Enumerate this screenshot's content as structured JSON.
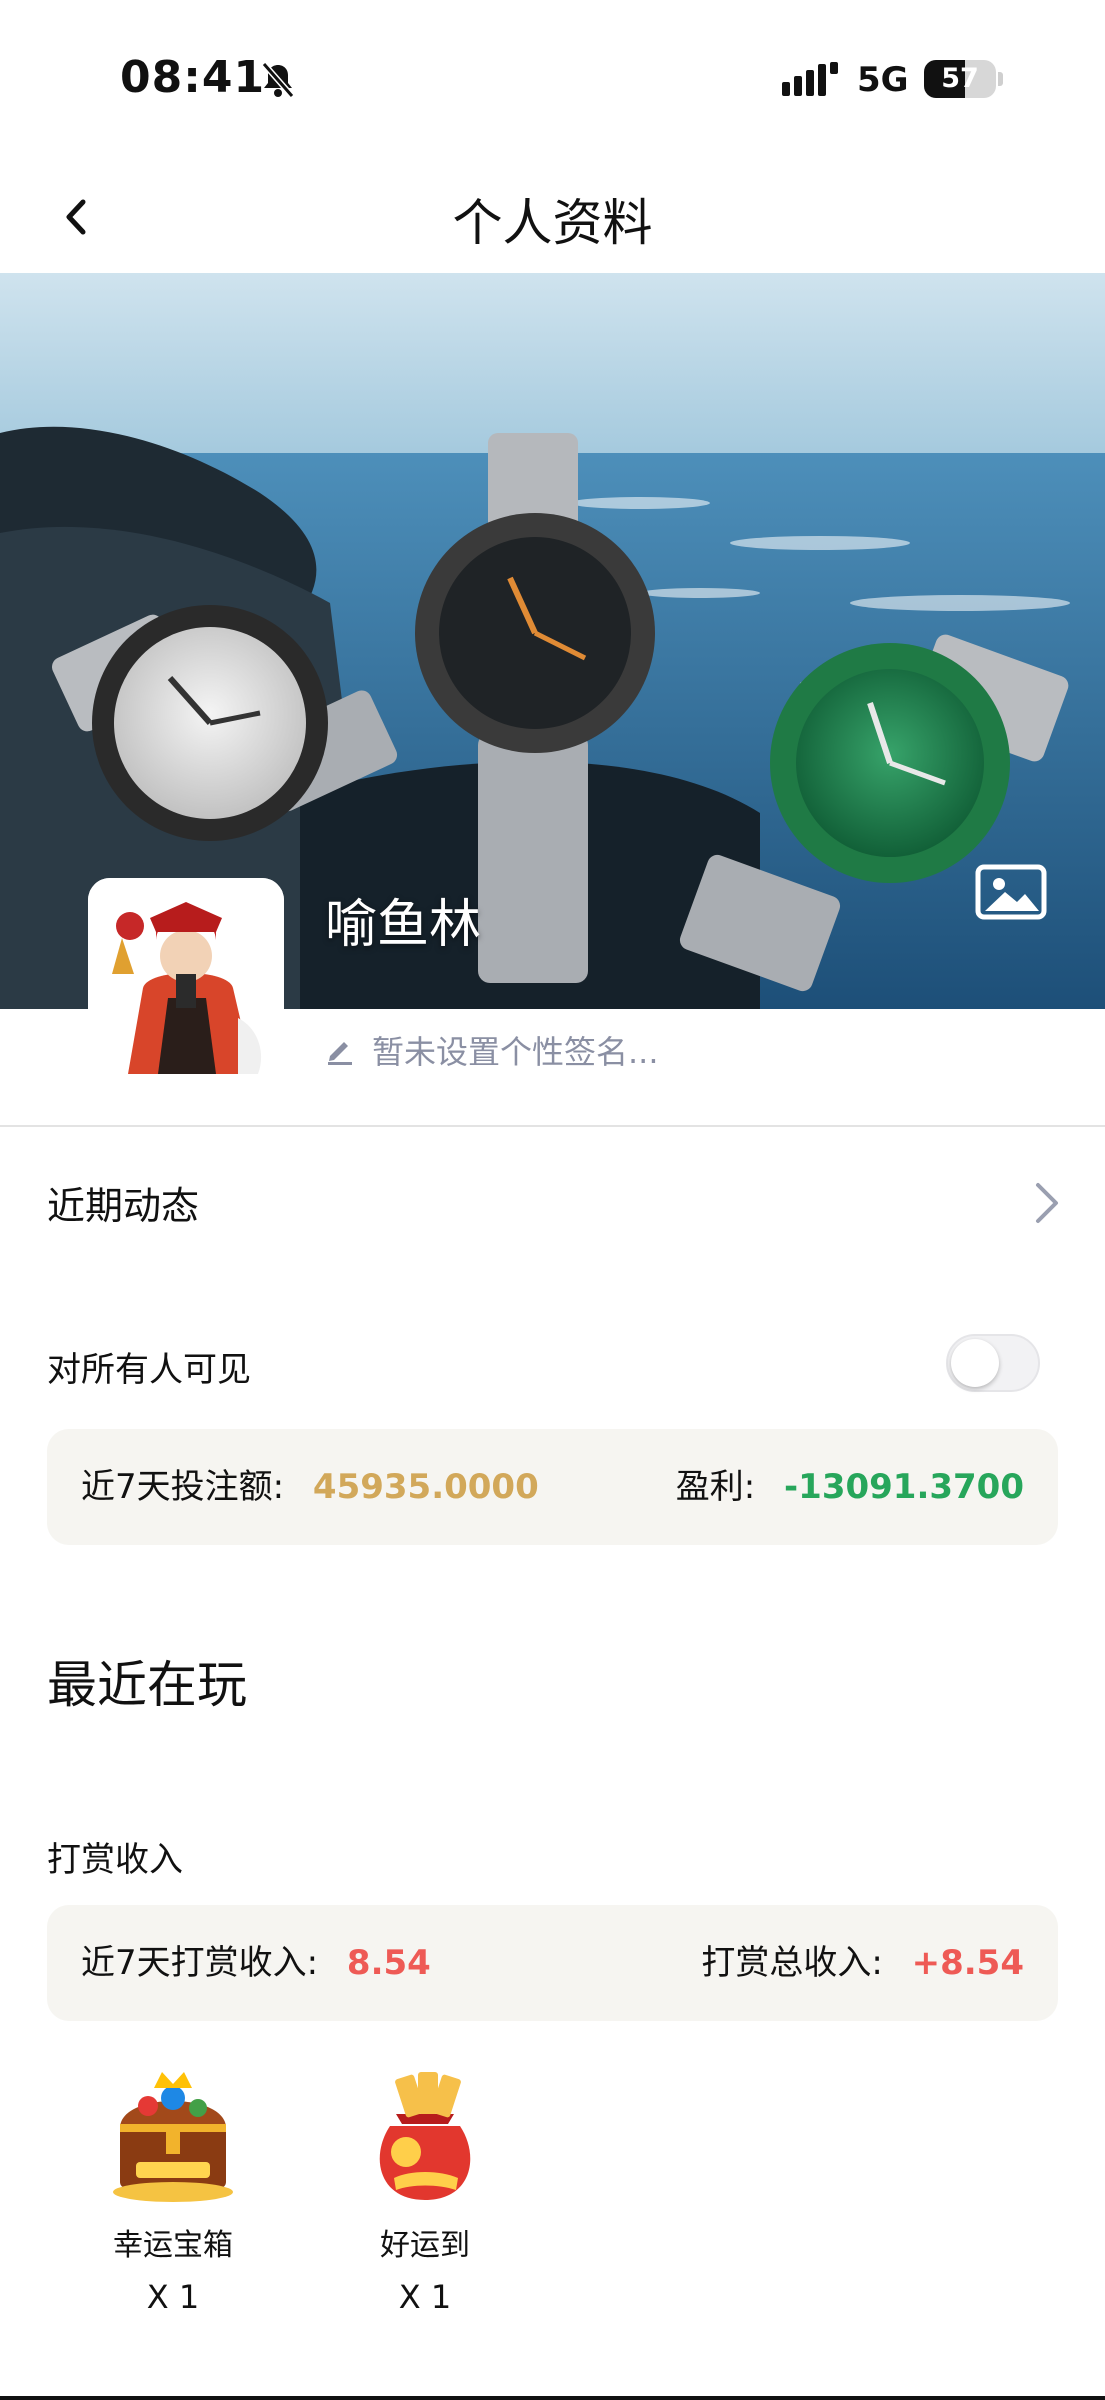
{
  "status_bar": {
    "time": "08:41",
    "network": "5G",
    "battery": "57",
    "battery_level": 0.57
  },
  "header": {
    "title": "个人资料"
  },
  "profile": {
    "username": "喻鱼林",
    "signature_placeholder": "暂未设置个性签名..."
  },
  "recent_activity": {
    "label": "近期动态"
  },
  "visibility": {
    "label": "对所有人可见",
    "enabled": false
  },
  "bet_stats": {
    "bet_label": "近7天投注额:",
    "bet_value": "45935.0000",
    "profit_label": "盈利:",
    "profit_value": "-13091.3700"
  },
  "recently_playing": {
    "heading": "最近在玩"
  },
  "tips": {
    "heading": "打赏收入",
    "week_label": "近7天打赏收入:",
    "week_value": "8.54",
    "total_label": "打赏总收入:",
    "total_value": "+8.54"
  },
  "gifts": [
    {
      "name": "幸运宝箱",
      "qty": "X 1",
      "icon": "treasure-chest-icon"
    },
    {
      "name": "好运到",
      "qty": "X 1",
      "icon": "lucky-bag-icon"
    }
  ],
  "colors": {
    "gold": "#d2a85a",
    "green": "#27a65b",
    "red": "#ee5a55",
    "card_bg": "#f6f5f1"
  }
}
